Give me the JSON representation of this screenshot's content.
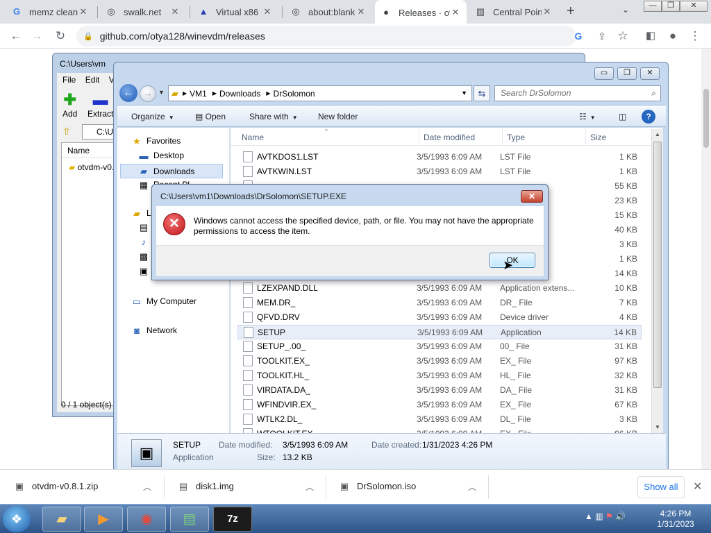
{
  "browser": {
    "tabs": [
      {
        "label": "memz clean",
        "icon": "G"
      },
      {
        "label": "swalk.net",
        "icon": "◎"
      },
      {
        "label": "Virtual x86",
        "icon": "▲"
      },
      {
        "label": "about:blank",
        "icon": "◎"
      },
      {
        "label": "Releases · ot",
        "icon": "●"
      },
      {
        "label": "Central Point",
        "icon": "▥"
      }
    ],
    "url": "github.com/otya128/winevdm/releases"
  },
  "zip": {
    "title": "C:\\Users\\vm",
    "menu": [
      "File",
      "Edit",
      "V"
    ],
    "add_label": "Add",
    "extract_label": "Extract",
    "path": "C:\\U",
    "col_name": "Name",
    "file": "otvdm-v0.",
    "status": "0 / 1 object(s) s"
  },
  "explorer": {
    "breadcrumb": [
      "VM1",
      "Downloads",
      "DrSolomon"
    ],
    "search_placeholder": "Search DrSolomon",
    "commands": {
      "organize": "Organize",
      "open": "Open",
      "share": "Share with",
      "newfolder": "New folder"
    },
    "nav": {
      "favorites": "Favorites",
      "desktop": "Desktop",
      "downloads": "Downloads",
      "recent": "Recent Pl",
      "libraries": "L",
      "computer": "My Computer",
      "network": "Network"
    },
    "columns": {
      "name": "Name",
      "date": "Date modified",
      "type": "Type",
      "size": "Size"
    },
    "files": [
      {
        "name": "AVTKDOS1.LST",
        "date": "3/5/1993 6:09 AM",
        "type": "LST File",
        "size": "1 KB"
      },
      {
        "name": "AVTKWIN.LST",
        "date": "3/5/1993 6:09 AM",
        "type": "LST File",
        "size": "1 KB"
      },
      {
        "name": "",
        "date": "",
        "type": "",
        "size": "55 KB"
      },
      {
        "name": "",
        "date": "",
        "type": "",
        "size": "23 KB"
      },
      {
        "name": "",
        "date": "",
        "type": "",
        "size": "15 KB"
      },
      {
        "name": "",
        "date": "",
        "type": "",
        "size": "40 KB"
      },
      {
        "name": "",
        "date": "",
        "type": "",
        "size": "3 KB"
      },
      {
        "name": "",
        "date": "",
        "type": "",
        "size": "1 KB"
      },
      {
        "name": "",
        "date": "",
        "type": "",
        "size": "14 KB"
      },
      {
        "name": "LZEXPAND.DLL",
        "date": "3/5/1993 6:09 AM",
        "type": "Application extens...",
        "size": "10 KB"
      },
      {
        "name": "MEM.DR_",
        "date": "3/5/1993 6:09 AM",
        "type": "DR_ File",
        "size": "7 KB"
      },
      {
        "name": "QFVD.DRV",
        "date": "3/5/1993 6:09 AM",
        "type": "Device driver",
        "size": "4 KB"
      },
      {
        "name": "SETUP",
        "date": "3/5/1993 6:09 AM",
        "type": "Application",
        "size": "14 KB"
      },
      {
        "name": "SETUP_.00_",
        "date": "3/5/1993 6:09 AM",
        "type": "00_ File",
        "size": "31 KB"
      },
      {
        "name": "TOOLKIT.EX_",
        "date": "3/5/1993 6:09 AM",
        "type": "EX_ File",
        "size": "97 KB"
      },
      {
        "name": "TOOLKIT.HL_",
        "date": "3/5/1993 6:09 AM",
        "type": "HL_ File",
        "size": "32 KB"
      },
      {
        "name": "VIRDATA.DA_",
        "date": "3/5/1993 6:09 AM",
        "type": "DA_ File",
        "size": "31 KB"
      },
      {
        "name": "WFINDVIR.EX_",
        "date": "3/5/1993 6:09 AM",
        "type": "EX_ File",
        "size": "67 KB"
      },
      {
        "name": "WTLK2.DL_",
        "date": "3/5/1993 6:09 AM",
        "type": "DL_ File",
        "size": "3 KB"
      },
      {
        "name": "WTOOLKIT.EX_",
        "date": "3/5/1993 6:09 AM",
        "type": "EX_ File",
        "size": "96 KB"
      }
    ],
    "details": {
      "name": "SETUP",
      "type": "Application",
      "modified_label": "Date modified:",
      "modified": "3/5/1993 6:09 AM",
      "created_label": "Date created:",
      "created": "1/31/2023 4:26 PM",
      "size_label": "Size:",
      "size": "13.2 KB"
    }
  },
  "dialog": {
    "title": "C:\\Users\\vm1\\Downloads\\DrSolomon\\SETUP.EXE",
    "message": "Windows cannot access the specified device, path, or file.  You may not have the appropriate permissions to access the item.",
    "ok": "OK"
  },
  "downloads": {
    "items": [
      "otvdm-v0.8.1.zip",
      "disk1.img",
      "DrSolomon.iso"
    ],
    "show_all": "Show all"
  },
  "clock": {
    "time": "4:26 PM",
    "date": "1/31/2023"
  }
}
